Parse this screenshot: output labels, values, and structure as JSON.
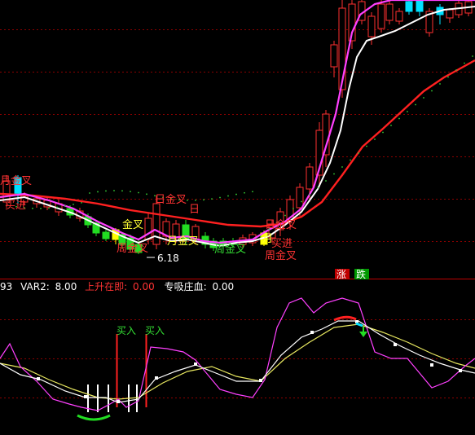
{
  "colors": {
    "background": "#000000",
    "grid": "#8b0000",
    "candle_up": "#ff3030",
    "candle_down": "#00e0ff",
    "candle_down_alt": "#22dd22",
    "candle_highlight": "#ffff00",
    "ma_white": "#ffffff",
    "ma_magenta": "#ff40ff",
    "ma_red": "#ff2020",
    "dots_green": "#33cc33",
    "label_red": "#ff3333",
    "label_yellow": "#ffff33",
    "label_green": "#33dd33",
    "indicator_yellow": "#e8e860",
    "indicator_white": "#ffffff",
    "indicator_magenta": "#ff40ff",
    "text_white": "#ffffff",
    "text_red": "#ff3333"
  },
  "main_labels": {
    "yuejincha_left": "月金叉",
    "maijin_left": "买进",
    "rijincha_mid": "日金叉",
    "jin_fork_mid": "金叉",
    "zhoujincha_left": "周金叉",
    "yuejincha_mid": "月金叉",
    "zhoujincha_mid": "周金叉",
    "rijincha_right": "日金叉",
    "maijin_right": "买进",
    "zhoujincha_right": "周金叉",
    "price_low": "6.18",
    "ri_short": "日",
    "yue_short": "月"
  },
  "buttons": {
    "zhang": "涨",
    "die": "跌"
  },
  "indicator_header": {
    "prefix": "93",
    "var2_label": "VAR2:",
    "var2_value": "8.00",
    "up_label": "上升在即:",
    "up_value": "0.00",
    "zhuangxue_label": "专吸庄血:",
    "zhuangxue_value": "0.00"
  },
  "indicator_labels": {
    "buy1": "买入",
    "buy2": "买入"
  }
}
